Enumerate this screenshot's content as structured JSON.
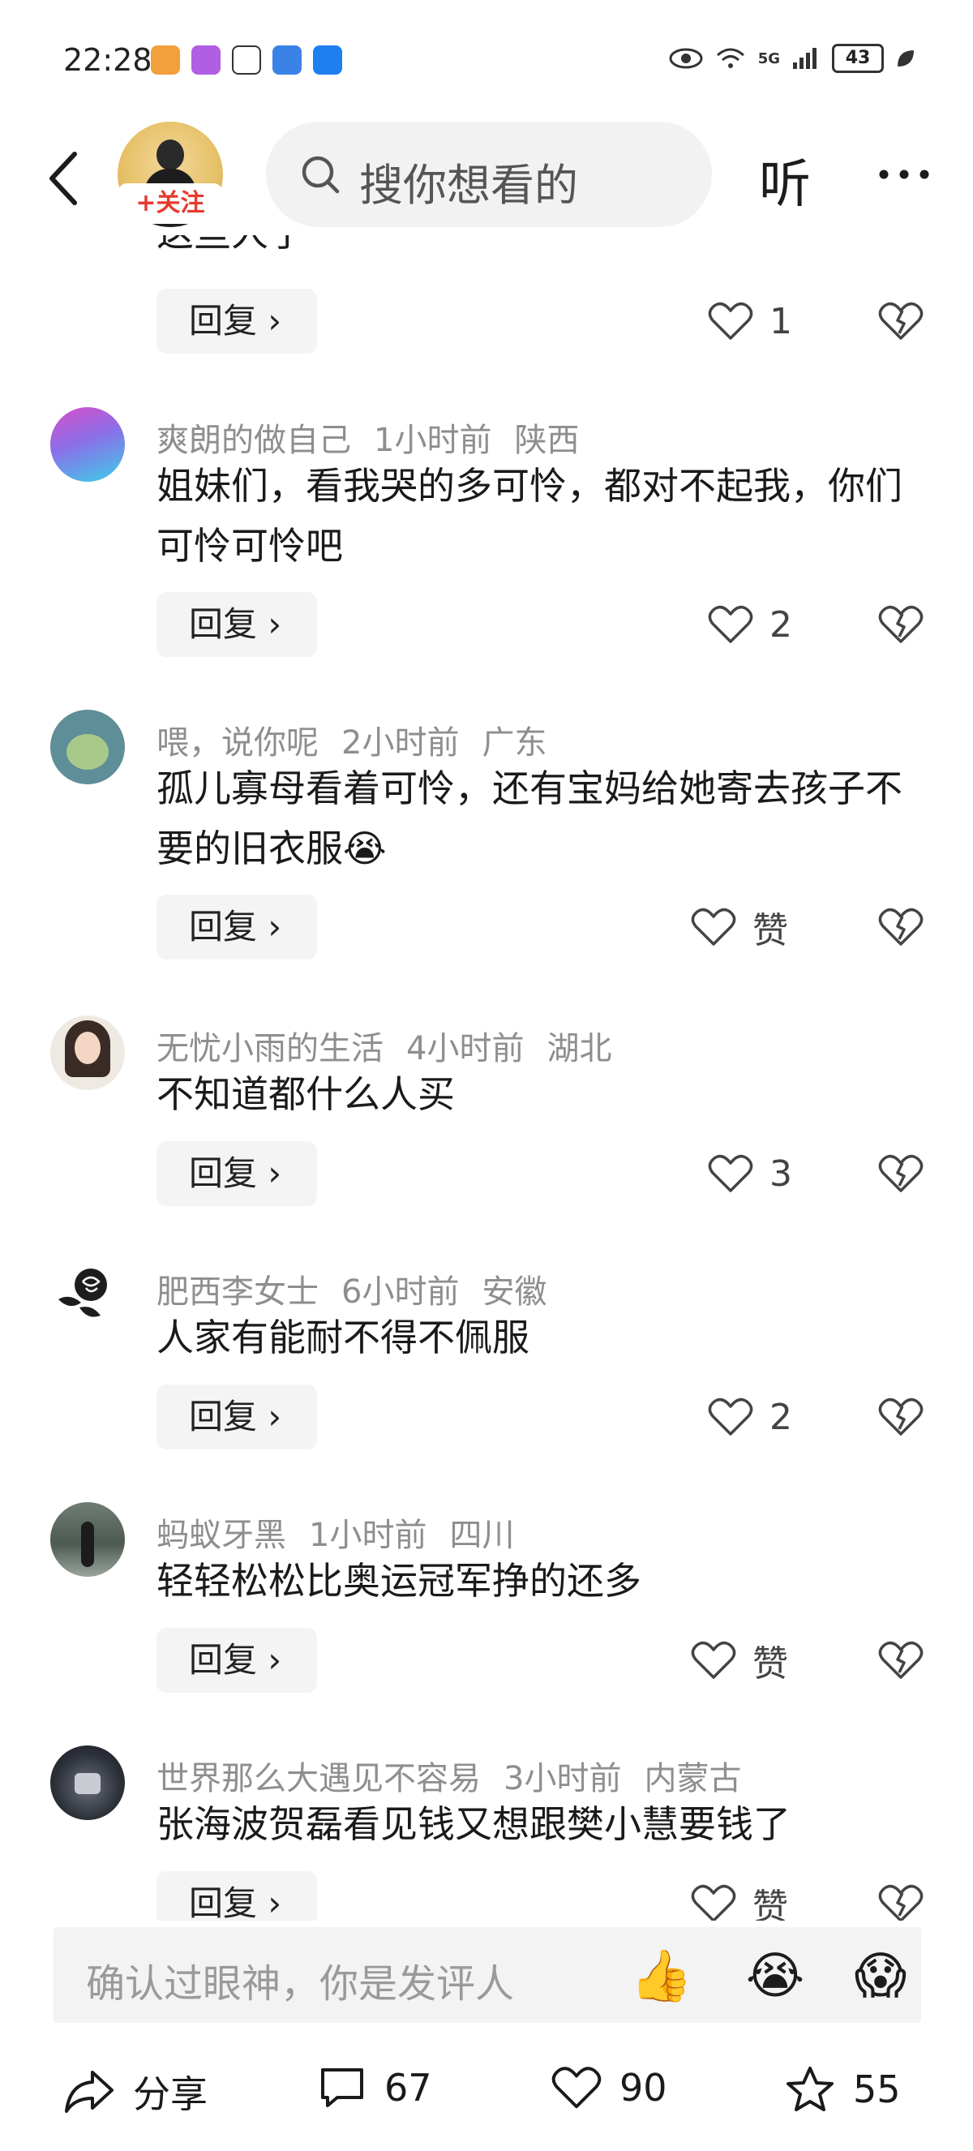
{
  "status_bar": {
    "time": "22:28",
    "battery": "43",
    "network_label": "5G"
  },
  "header": {
    "follow_label": "+关注",
    "search_placeholder": "搜你想看的",
    "listen_label": "听"
  },
  "comments": [
    {
      "text": "这些人了",
      "likes": "1",
      "reply_label": "回复 ›"
    },
    {
      "user": "爽朗的做自己",
      "time": "1小时前",
      "region": "陕西",
      "text": "姐妹们，看我哭的多可怜，都对不起我，你们可怜可怜吧",
      "likes": "2",
      "reply_label": "回复 ›"
    },
    {
      "user": "喂，说你呢",
      "time": "2小时前",
      "region": "广东",
      "text": "孤儿寡母看着可怜，还有宝妈给她寄去孩子不要的旧衣服😭",
      "likes": "赞",
      "reply_label": "回复 ›"
    },
    {
      "user": "无忧小雨的生活",
      "time": "4小时前",
      "region": "湖北",
      "text": "不知道都什么人买",
      "likes": "3",
      "reply_label": "回复 ›"
    },
    {
      "user": "肥西李女士",
      "time": "6小时前",
      "region": "安徽",
      "text": "人家有能耐不得不佩服",
      "likes": "2",
      "reply_label": "回复 ›"
    },
    {
      "user": "蚂蚁牙黑",
      "time": "1小时前",
      "region": "四川",
      "text": "轻轻松松比奥运冠军挣的还多",
      "likes": "赞",
      "reply_label": "回复 ›"
    },
    {
      "user": "世界那么大遇见不容易",
      "time": "3小时前",
      "region": "内蒙古",
      "text": "张海波贺磊看见钱又想跟樊小慧要钱了",
      "likes": "赞",
      "reply_label": "回复 ›"
    }
  ],
  "input_bar": {
    "placeholder": "确认过眼神，你是发评人",
    "emoji_thumbs": "👍",
    "emoji_cry": "😭",
    "emoji_scared": "😱"
  },
  "bottom_bar": {
    "share_label": "分享",
    "comment_count": "67",
    "like_count": "90",
    "favorite_count": "55"
  },
  "colors": {
    "accent": "#e63b2e",
    "meta_gray": "#8e8e8e",
    "chip_bg": "#f4f4f4"
  }
}
